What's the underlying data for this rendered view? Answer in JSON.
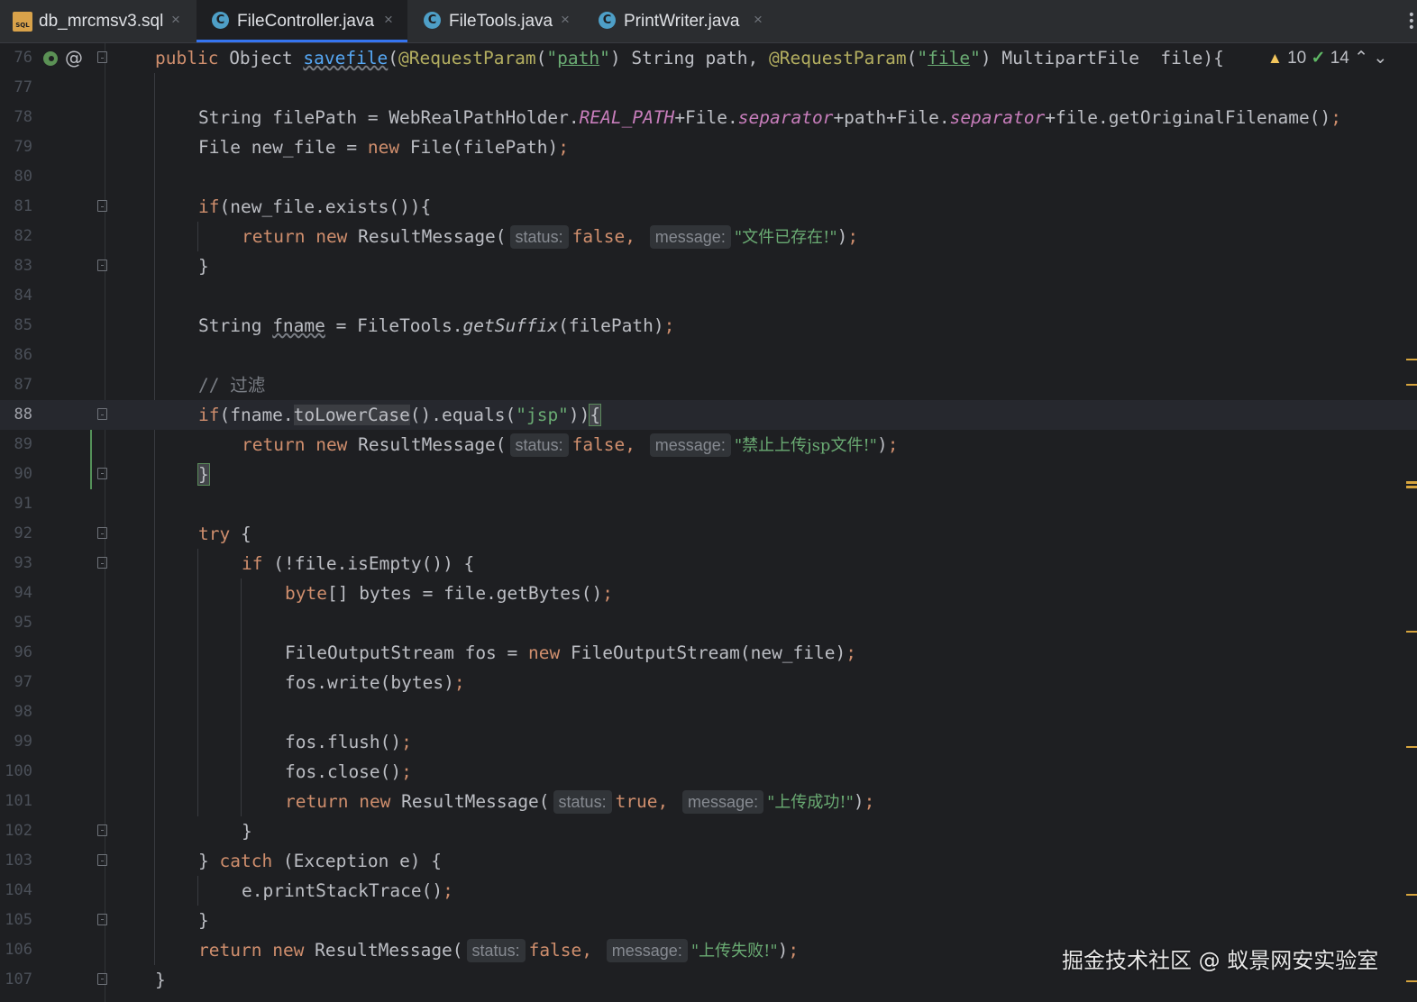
{
  "tabs": [
    {
      "label": "db_mrcmsv3.sql",
      "icon": "sql-file-icon",
      "active": false
    },
    {
      "label": "FileController.java",
      "icon": "java-class-icon",
      "active": true
    },
    {
      "label": "FileTools.java",
      "icon": "java-class-icon",
      "active": false
    },
    {
      "label": "PrintWriter.java",
      "icon": "java-class-icon",
      "active": false
    }
  ],
  "tab_close_glyph": "×",
  "inspections": {
    "warnings": "10",
    "weak_warnings": "14"
  },
  "gutter": {
    "at_symbol": "@"
  },
  "hints": {
    "status": "status:",
    "message": "message:"
  },
  "code": {
    "l76": {
      "ln": "76",
      "kw_public": "public",
      "t1": " Object ",
      "method": "savefile",
      "t2": "(",
      "ann1": "@RequestParam",
      "t3": "(",
      "s1a": "\"",
      "s1b": "path",
      "s1c": "\"",
      "t4": ") String path, ",
      "ann2": "@RequestParam",
      "t5": "(",
      "s2a": "\"",
      "s2b": "file",
      "s2c": "\"",
      "t6": ") MultipartFile  file){"
    },
    "l77": {
      "ln": "77"
    },
    "l78": {
      "ln": "78",
      "t1": "String filePath = WebRealPathHolder.",
      "st1": "REAL_PATH",
      "t2": "+File.",
      "st2": "separator",
      "t3": "+path+File.",
      "st3": "separator",
      "t4": "+file.getOriginalFilename()",
      "semi": ";"
    },
    "l79": {
      "ln": "79",
      "t1": "File new_file = ",
      "kw": "new",
      "t2": " File(filePath)",
      "semi": ";"
    },
    "l80": {
      "ln": "80"
    },
    "l81": {
      "ln": "81",
      "kw": "if",
      "t1": "(new_file.exists()){"
    },
    "l82": {
      "ln": "82",
      "kw1": "return",
      "kw2": "new",
      "t1": " ResultMessage(",
      "val": "false",
      "comma": ",",
      "str": "\"文件已存在!\"",
      "t2": ")",
      "semi": ";"
    },
    "l83": {
      "ln": "83",
      "t1": "}"
    },
    "l84": {
      "ln": "84"
    },
    "l85": {
      "ln": "85",
      "t1": "String ",
      "var": "fname",
      "t2": " = FileTools.",
      "it": "getSuffix",
      "t3": "(filePath)",
      "semi": ";"
    },
    "l86": {
      "ln": "86"
    },
    "l87": {
      "ln": "87",
      "comment": "// 过滤"
    },
    "l88": {
      "ln": "88",
      "kw": "if",
      "t1": "(fname.",
      "hl": "toLowerCase",
      "t2": "().equals(",
      "str": "\"jsp\"",
      "t3": "))",
      "brace": "{"
    },
    "l89": {
      "ln": "89",
      "kw1": "return",
      "kw2": "new",
      "t1": " ResultMessage(",
      "val": "false",
      "comma": ",",
      "str": "\"禁止上传jsp文件!\"",
      "t2": ")",
      "semi": ";"
    },
    "l90": {
      "ln": "90",
      "brace": "}"
    },
    "l91": {
      "ln": "91"
    },
    "l92": {
      "ln": "92",
      "kw": "try",
      "t1": " {"
    },
    "l93": {
      "ln": "93",
      "kw": "if",
      "t1": " (!file.isEmpty()) {"
    },
    "l94": {
      "ln": "94",
      "kw": "byte",
      "t1": "[] bytes = file.getBytes()",
      "semi": ";"
    },
    "l95": {
      "ln": "95"
    },
    "l96": {
      "ln": "96",
      "t1": "FileOutputStream fos = ",
      "kw": "new",
      "t2": " FileOutputStream(new_file)",
      "semi": ";"
    },
    "l97": {
      "ln": "97",
      "t1": "fos.write(bytes)",
      "semi": ";"
    },
    "l98": {
      "ln": "98"
    },
    "l99": {
      "ln": "99",
      "t1": "fos.flush()",
      "semi": ";"
    },
    "l100": {
      "ln": "100",
      "t1": "fos.close()",
      "semi": ";"
    },
    "l101": {
      "ln": "101",
      "kw1": "return",
      "kw2": "new",
      "t1": " ResultMessage(",
      "val": "true",
      "comma": ",",
      "str": "\"上传成功!\"",
      "t2": ")",
      "semi": ";"
    },
    "l102": {
      "ln": "102",
      "t1": "}"
    },
    "l103": {
      "ln": "103",
      "t1": "} ",
      "kw": "catch",
      "t2": " (Exception e) {"
    },
    "l104": {
      "ln": "104",
      "t1": "e.printStackTrace()",
      "semi": ";"
    },
    "l105": {
      "ln": "105",
      "t1": "}"
    },
    "l106": {
      "ln": "106",
      "kw1": "return",
      "kw2": "new",
      "t1": " ResultMessage(",
      "val": "false",
      "comma": ",",
      "str": "\"上传失败!\"",
      "t2": ")",
      "semi": ";"
    },
    "l107": {
      "ln": "107",
      "t1": "}"
    }
  },
  "watermark": "掘金技术社区 @ 蚁景网安实验室",
  "colors": {
    "keyword": "#cf8e6d",
    "string": "#6aab73",
    "annotation": "#b3ae60",
    "static_field": "#c77dbb",
    "background": "#1e1f22",
    "accent": "#3574f0"
  }
}
